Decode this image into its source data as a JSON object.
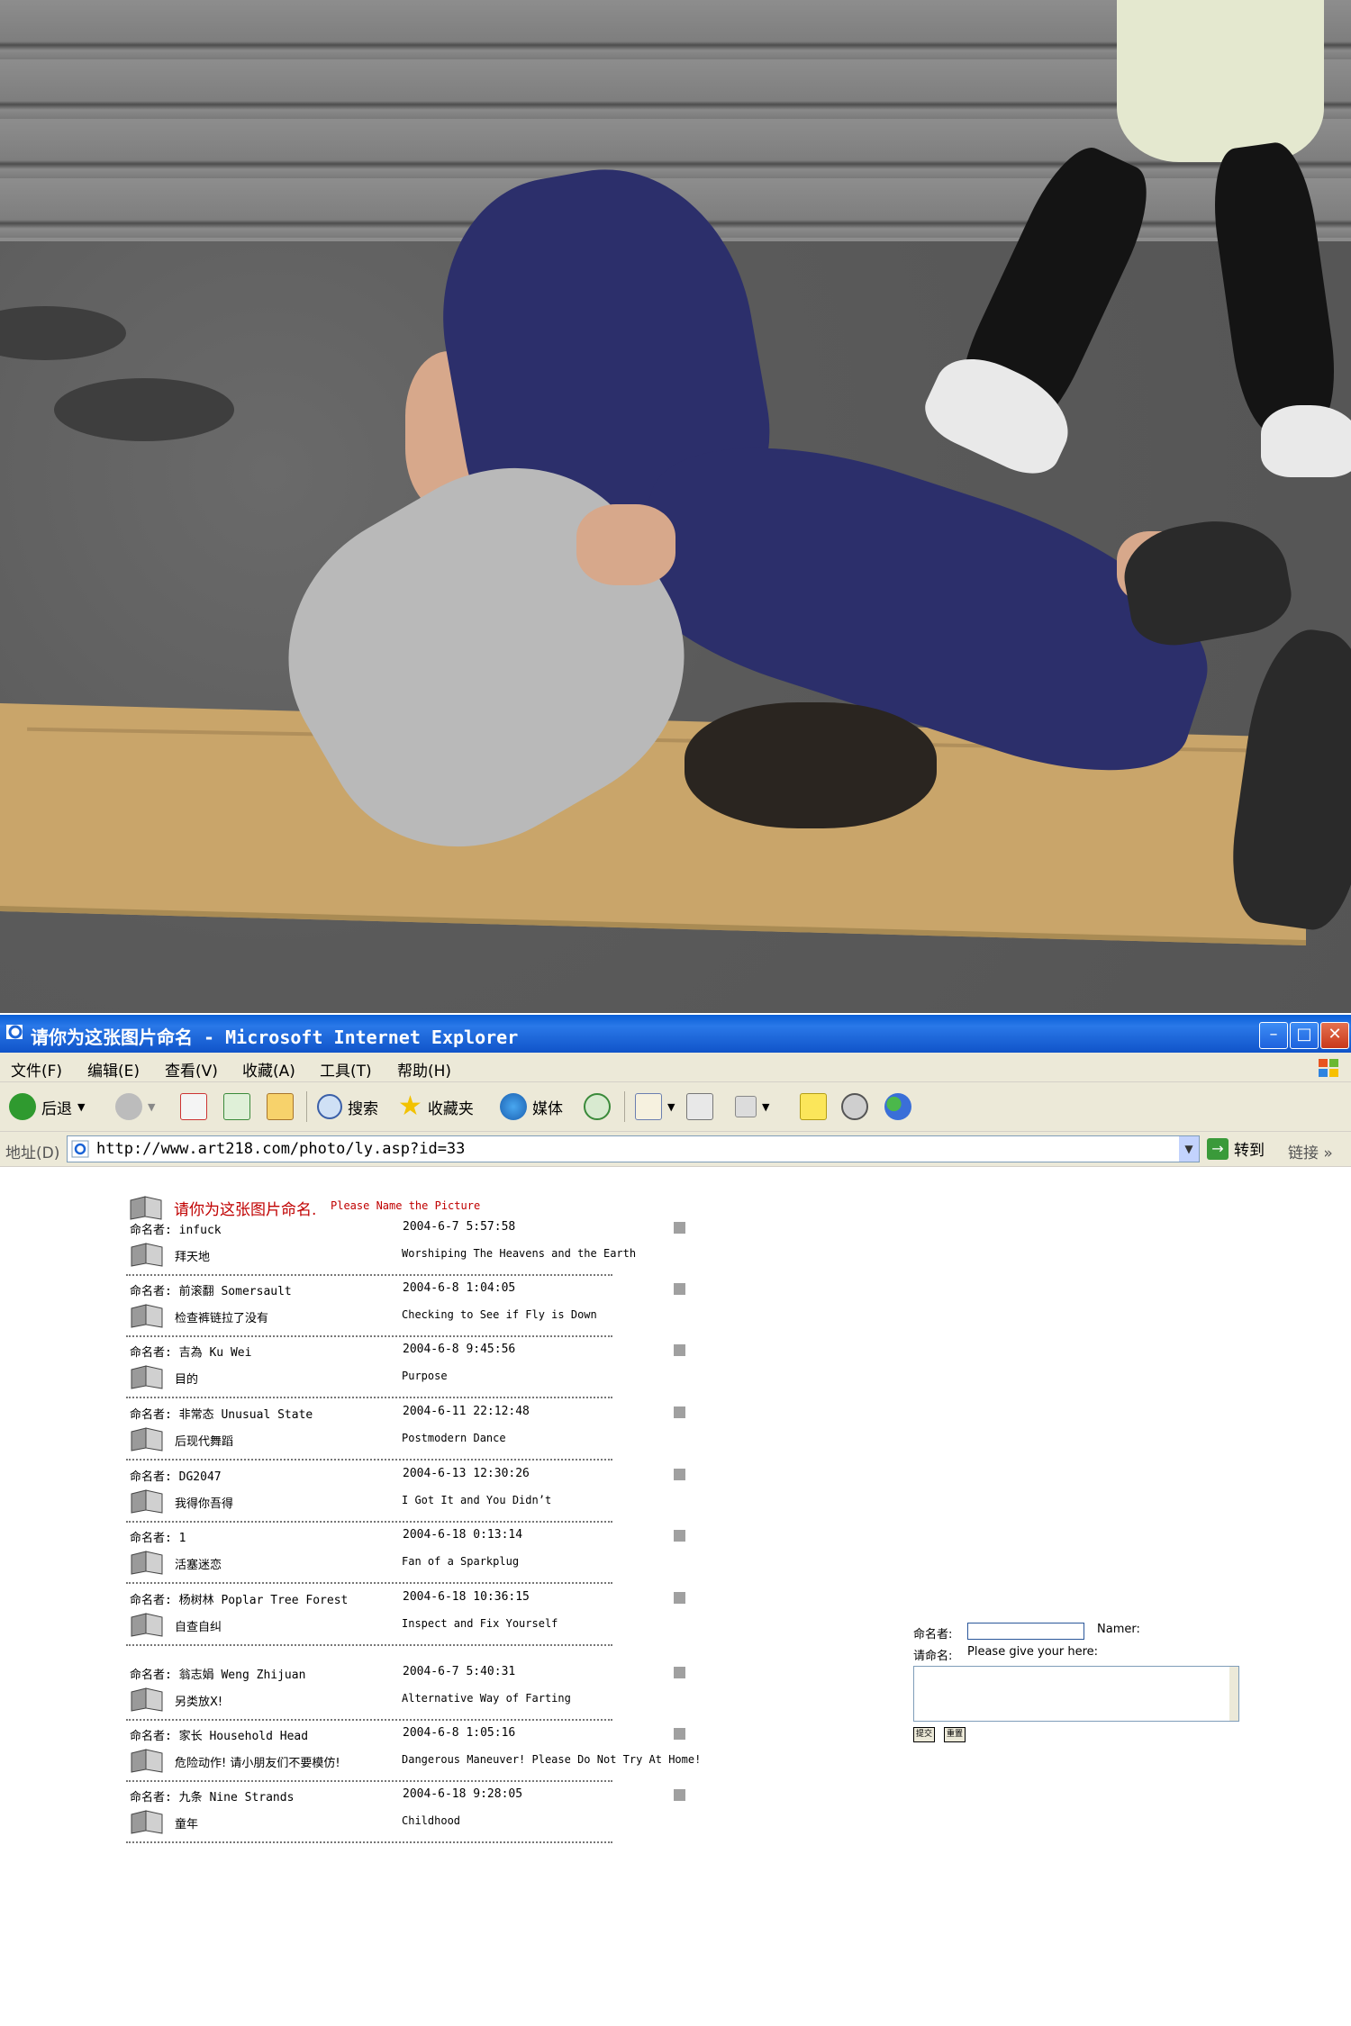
{
  "window": {
    "title": "请你为这张图片命名 - Microsoft Internet Explorer",
    "controls": {
      "minimize": "–",
      "maximize": "□",
      "close": "✕"
    }
  },
  "menubar": {
    "items": [
      "文件(F)",
      "编辑(E)",
      "查看(V)",
      "收藏(A)",
      "工具(T)",
      "帮助(H)"
    ]
  },
  "toolbar": {
    "back": "后退",
    "search": "搜索",
    "favorites": "收藏夹",
    "media": "媒体"
  },
  "address": {
    "label": "地址(D)",
    "url": "http://www.art218.com/photo/ly.asp?id=33",
    "go": "转到",
    "links": "链接"
  },
  "page": {
    "header_cn": "请你为这张图片命名.",
    "header_en": "Please Name the Picture",
    "entries": [
      {
        "namer": "命名者: infuck",
        "date": "2004-6-7 5:57:58",
        "title_cn": "拜天地",
        "title_en": "Worshiping The Heavens and the Earth"
      },
      {
        "namer": "命名者: 前滚翻 Somersault",
        "date": "2004-6-8 1:04:05",
        "title_cn": "检查裤链拉了没有",
        "title_en": "Checking to See if Fly is Down"
      },
      {
        "namer": "命名者: 吉為   Ku Wei",
        "date": "2004-6-8 9:45:56",
        "title_cn": "目的",
        "title_en": "Purpose"
      },
      {
        "namer": "命名者: 非常态 Unusual State",
        "date": "2004-6-11 22:12:48",
        "title_cn": "后现代舞蹈",
        "title_en": "Postmodern Dance"
      },
      {
        "namer": "命名者: DG2047",
        "date": "2004-6-13 12:30:26",
        "title_cn": "我得你吾得",
        "title_en": "I Got It and You Didn’t"
      },
      {
        "namer": "命名者: 1",
        "date": "2004-6-18 0:13:14",
        "title_cn": "活塞迷恋",
        "title_en": "Fan of a Sparkplug"
      },
      {
        "namer": "命名者: 杨树林 Poplar Tree Forest",
        "date": "2004-6-18 10:36:15",
        "title_cn": "自查自纠",
        "title_en": "Inspect and Fix Yourself"
      },
      {
        "namer": "命名者: 翁志娟 Weng Zhijuan",
        "date": "2004-6-7 5:40:31",
        "title_cn": "另类放X!",
        "title_en": "Alternative Way of Farting"
      },
      {
        "namer": "命名者: 家长   Household Head",
        "date": "2004-6-8 1:05:16",
        "title_cn": "危险动作! 请小朋友们不要模仿!",
        "title_en": "Dangerous Maneuver! Please Do Not Try At Home!"
      },
      {
        "namer": "命名者: 九条   Nine Strands",
        "date": "2004-6-18 9:28:05",
        "title_cn": "童年",
        "title_en": "Childhood"
      }
    ]
  },
  "form": {
    "namer_label": "命名者:",
    "namer_en": "Namer:",
    "namer_value": "",
    "title_label": "请命名:",
    "title_en": "Please give your here:",
    "title_value": "",
    "submit": "提交",
    "reset": "重置"
  }
}
